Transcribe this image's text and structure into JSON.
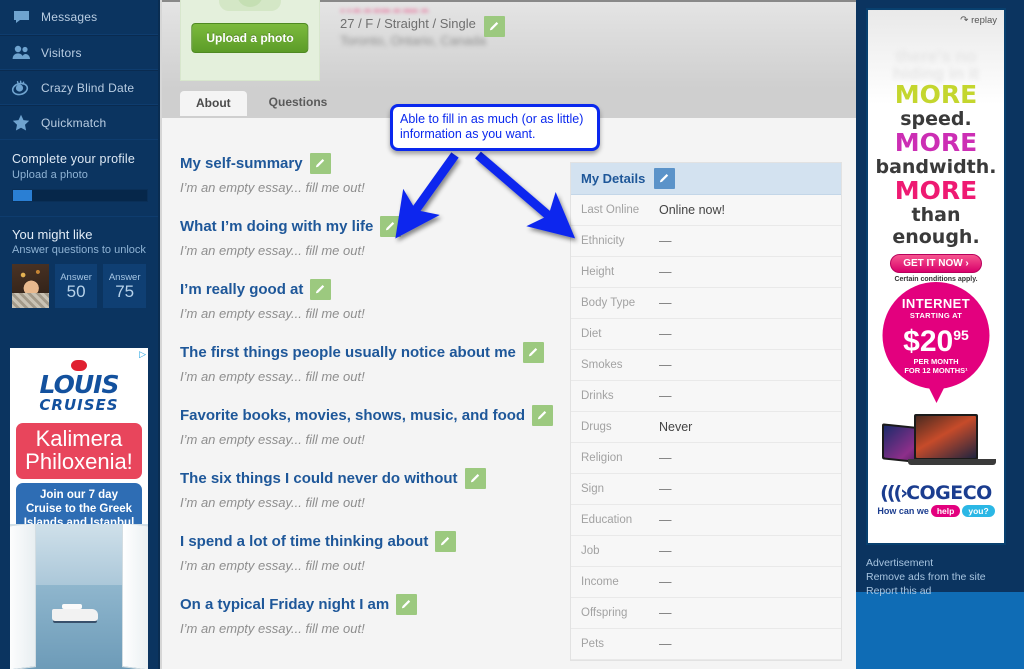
{
  "sidebar": {
    "nav": [
      {
        "label": "Messages",
        "icon": "message-icon"
      },
      {
        "label": "Visitors",
        "icon": "visitors-icon"
      },
      {
        "label": "Crazy Blind Date",
        "icon": "eye-icon"
      },
      {
        "label": "Quickmatch",
        "icon": "star-icon"
      }
    ],
    "complete": {
      "title": "Complete your profile",
      "subtitle": "Upload a photo",
      "progress_percent": 14
    },
    "you_might_like": {
      "title": "You might like",
      "subtitle": "Answer questions to unlock",
      "tiles": [
        {
          "label": "Answer",
          "value": "50"
        },
        {
          "label": "Answer",
          "value": "75"
        }
      ]
    },
    "ad": {
      "adchoices": "▷",
      "brand_line1": "LOUIS",
      "brand_line2": "CRUISES",
      "headline": "Kalimera\nPhiloxenia!",
      "subhead": "Join our 7 day Cruise to the Greek Islands and Istanbul"
    }
  },
  "hero": {
    "name_blurred": "username",
    "stats": "27 / F / Straight / Single",
    "location_blurred": "Toronto, Ontario, Canada",
    "upload_label": "Upload a photo",
    "edit_icon": "pencil-icon"
  },
  "tabs": [
    {
      "label": "About",
      "active": true
    },
    {
      "label": "Questions",
      "active": false
    }
  ],
  "essays": [
    {
      "title": "My self-summary",
      "body": "I’m an empty essay... fill me out!"
    },
    {
      "title": "What I’m doing with my life",
      "body": "I’m an empty essay... fill me out!"
    },
    {
      "title": "I’m really good at",
      "body": "I’m an empty essay... fill me out!"
    },
    {
      "title": "The first things people usually notice about me",
      "body": "I’m an empty essay... fill me out!"
    },
    {
      "title": "Favorite books, movies, shows, music, and food",
      "body": "I’m an empty essay... fill me out!"
    },
    {
      "title": "The six things I could never do without",
      "body": "I’m an empty essay... fill me out!"
    },
    {
      "title": "I spend a lot of time thinking about",
      "body": "I’m an empty essay... fill me out!"
    },
    {
      "title": "On a typical Friday night I am",
      "body": "I’m an empty essay... fill me out!"
    }
  ],
  "details": {
    "title": "My Details",
    "edit_icon": "pencil-icon",
    "rows": [
      {
        "key": "Last Online",
        "value": "Online now!"
      },
      {
        "key": "Ethnicity",
        "value": "—"
      },
      {
        "key": "Height",
        "value": "—"
      },
      {
        "key": "Body Type",
        "value": "—"
      },
      {
        "key": "Diet",
        "value": "—"
      },
      {
        "key": "Smokes",
        "value": "—"
      },
      {
        "key": "Drinks",
        "value": "—"
      },
      {
        "key": "Drugs",
        "value": "Never"
      },
      {
        "key": "Religion",
        "value": "—"
      },
      {
        "key": "Sign",
        "value": "—"
      },
      {
        "key": "Education",
        "value": "—"
      },
      {
        "key": "Job",
        "value": "—"
      },
      {
        "key": "Income",
        "value": "—"
      },
      {
        "key": "Offspring",
        "value": "—"
      },
      {
        "key": "Pets",
        "value": "—"
      }
    ]
  },
  "annotation": {
    "text": "Able to fill in as much (or as little) information as you want.",
    "color": "#0a28ee"
  },
  "rail_ad": {
    "replay": "replay",
    "ghost_line": "there's no hiding in it",
    "more_1": "MORE",
    "sub_1": "speed.",
    "more_2": "MORE",
    "sub_2": "bandwidth.",
    "more_3": "MORE",
    "sub_3": "than enough.",
    "cta": "GET IT NOW  ›",
    "fine_print": "Certain conditions apply.",
    "bubble_1": "INTERNET",
    "bubble_2": "STARTING AT",
    "bubble_price": "$20",
    "bubble_cents": "95",
    "bubble_4": "PER MONTH\nFOR 12 MONTHS¹",
    "brand": "COGECO",
    "tagline_pre": "How can we",
    "tagline_pill1": "help",
    "tagline_pill2": "you?",
    "links": [
      "Advertisement",
      "Remove ads from the site",
      "Report this ad"
    ]
  },
  "colors": {
    "sidebar_bg": "#0b3460",
    "accent_blue": "#1e5799",
    "green": "#5c9c28",
    "pink": "#e8447f",
    "annotation": "#0a28ee"
  }
}
